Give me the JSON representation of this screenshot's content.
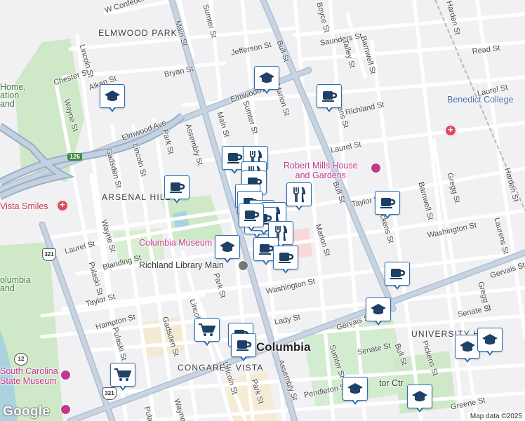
{
  "map": {
    "attribution": "Map data ©2025",
    "logo_text": "Google",
    "city_label": "Columbia",
    "areas": [
      "ELMWOOD PARK",
      "ARSENAL HILL",
      "CONGAREE VISTA",
      "UNIVERSITY H"
    ],
    "pois": {
      "robert_mills": "Robert Mills House\nand Gardens",
      "museum": "Columbia Museum",
      "library": "Richland Library Main",
      "benedict": "Benedict College",
      "vista_smiles": "Vista Smiles",
      "home": "Home,\nation\nand",
      "columbia_land": "olumbia\nand",
      "sc_museum": "South Carolina\nState Museum",
      "center": "tor Ctr"
    },
    "streets": {
      "w_confederate": "W Confederate Ave",
      "main_top": "Main St",
      "sumter_top": "Sumter St",
      "boyce": "Boyce St",
      "harden_top": "Harden St",
      "saunders": "Saunders St",
      "barnwell_top": "Barnwell St",
      "talley": "Talley St",
      "read": "Read St",
      "jefferson": "Jefferson St",
      "chester": "Chester St",
      "lincoln_top": "Lincoln St",
      "bryan": "Bryan St",
      "bull_top": "Bull St",
      "laurel_right": "Laurel St",
      "aiken": "Aiken St",
      "elmwood_ave": "Elmwood Ave",
      "elmwood_av2": "Elmwood Ave",
      "marion_top": "Marion St",
      "pickens_top": "ckens St",
      "richland": "Richland St",
      "wayne_top": "Wayne St",
      "main_mid": "Main St",
      "sumter_mid": "Sumter St",
      "laurel_mid": "Laurel St",
      "assembly": "Assembly St",
      "park_top": "Park St",
      "gadsden": "Gadsden St",
      "lincoln_mid": "Lincoln St",
      "gregg": "Gregg St",
      "harden_right": "Harden St",
      "barnwell_right": "Barnwell St",
      "bull_mid": "Bull St",
      "taylor_right": "Taylor St",
      "pickens_mid": "Pickens St",
      "washington_right": "Washington St",
      "laurens": "Laurens St",
      "wayne_mid": "Wayne St",
      "laurel_left": "Laurel St",
      "blanding": "Blanding St",
      "marion_mid": "Marion St",
      "pulaski": "Pulaski St",
      "taylor_left": "Taylor St",
      "washington_mid": "Washington St",
      "park_mid": "Park St",
      "gervais": "Gervais St",
      "gervais_right": "Gervais St",
      "gregg_low": "Gregg St",
      "senate_right": "Senate St",
      "hampton": "Hampton St",
      "lady": "Lady St",
      "lincoln_low": "Lincoln St",
      "gadsden_low": "Gadsden St",
      "pulaski_low": "Pulaski St",
      "senate_low": "Senate St",
      "bull_low": "Bull St",
      "pickens_low": "Pickens St",
      "sumter_low": "Sumter St",
      "assembly_low": "Assembly St",
      "park_low": "Park St",
      "lincoln_bottom": "Lincoln St",
      "pendleton": "Pendleton St",
      "greene": "Greene St",
      "wayne_low": "Wayne",
      "pulaski_bottom": "Pula"
    },
    "highway_shields": [
      "126",
      "321",
      "321",
      "12"
    ],
    "markers": [
      {
        "kind": "school",
        "name": "school-marker"
      },
      {
        "kind": "school",
        "name": "school-marker"
      },
      {
        "kind": "cafe",
        "name": "cafe-marker"
      },
      {
        "kind": "cafe",
        "name": "cafe-marker"
      },
      {
        "kind": "restaurant",
        "name": "restaurant-marker"
      },
      {
        "kind": "cafe",
        "name": "cafe-marker"
      },
      {
        "kind": "restaurant",
        "name": "restaurant-marker"
      },
      {
        "kind": "cafe",
        "name": "cafe-marker"
      },
      {
        "kind": "restaurant",
        "name": "restaurant-marker"
      },
      {
        "kind": "cafe",
        "name": "cafe-marker"
      },
      {
        "kind": "cafe",
        "name": "cafe-marker"
      },
      {
        "kind": "shop",
        "name": "shopping-marker"
      },
      {
        "kind": "restaurant",
        "name": "restaurant-marker"
      },
      {
        "kind": "school",
        "name": "school-marker"
      },
      {
        "kind": "cafe",
        "name": "cafe-marker"
      },
      {
        "kind": "cafe",
        "name": "cafe-marker"
      },
      {
        "kind": "cafe",
        "name": "cafe-marker"
      },
      {
        "kind": "school",
        "name": "school-marker"
      },
      {
        "kind": "grocery",
        "name": "grocery-marker"
      },
      {
        "kind": "grocery",
        "name": "grocery-marker"
      },
      {
        "kind": "cafe",
        "name": "cafe-marker"
      },
      {
        "kind": "cafe",
        "name": "cafe-marker"
      },
      {
        "kind": "grocery",
        "name": "grocery-marker"
      },
      {
        "kind": "school",
        "name": "school-marker"
      },
      {
        "kind": "school",
        "name": "school-marker"
      },
      {
        "kind": "school",
        "name": "school-marker"
      },
      {
        "kind": "school",
        "name": "school-marker"
      }
    ]
  }
}
